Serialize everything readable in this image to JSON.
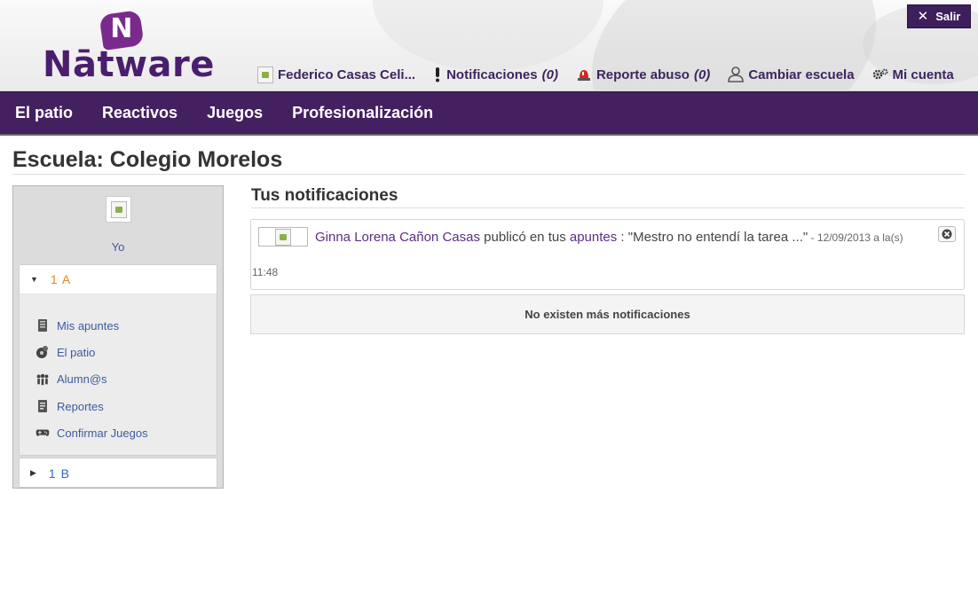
{
  "brand": {
    "badge_letter": "N",
    "wordmark": "Nātware",
    "primary_color": "#43205f"
  },
  "header": {
    "exit_label": "Salir",
    "user_name": "Federico Casas Celi...",
    "notifications_label": "Notificaciones",
    "notifications_count": "(0)",
    "abuse_label": "Reporte abuso",
    "abuse_count": "(0)",
    "change_school_label": "Cambiar escuela",
    "account_label": "Mi cuenta"
  },
  "mainnav": {
    "items": [
      "El patio",
      "Reactivos",
      "Juegos",
      "Profesionalización"
    ]
  },
  "page": {
    "title": "Escuela: Colegio Morelos"
  },
  "sidebar": {
    "me_label": "Yo",
    "groups": [
      {
        "label": "1 A",
        "expanded": true,
        "items": [
          {
            "label": "Mis apuntes",
            "icon": "notebook-icon"
          },
          {
            "label": "El patio",
            "icon": "patio-icon"
          },
          {
            "label": "Alumn@s",
            "icon": "students-icon"
          },
          {
            "label": "Reportes",
            "icon": "reports-icon"
          },
          {
            "label": "Confirmar Juegos",
            "icon": "gamepad-icon"
          }
        ]
      },
      {
        "label": "1 B",
        "expanded": false,
        "items": []
      }
    ]
  },
  "notifications": {
    "title": "Tus notificaciones",
    "items": [
      {
        "author": "Ginna Lorena Cañon Casas",
        "action": " publicó en tus ",
        "target": "apuntes",
        "text": " : \"Mestro no entendí la tarea ...\"",
        "date": " - 12/09/2013 a la(s)",
        "time": "11:48"
      }
    ],
    "no_more_label": "No existen más notificaciones"
  }
}
